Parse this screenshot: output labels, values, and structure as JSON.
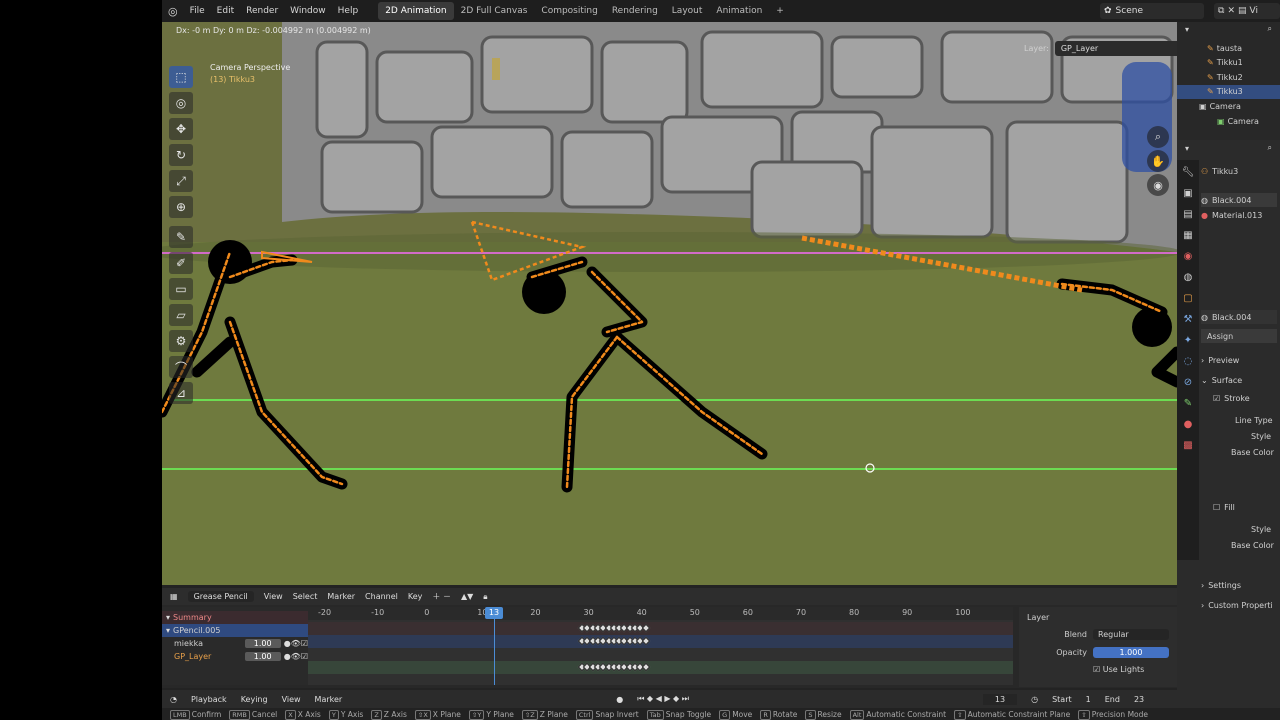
{
  "topbar": {
    "menu": [
      "File",
      "Edit",
      "Render",
      "Window",
      "Help"
    ],
    "workspaces": [
      "2D Animation",
      "2D Full Canvas",
      "Compositing",
      "Rendering",
      "Layout",
      "Animation",
      "+"
    ],
    "active_workspace": "2D Animation",
    "scene": "Scene",
    "view_layer": "Vi"
  },
  "viewport": {
    "header_text": "Dx: -0 m  Dy: 0 m  Dz: -0.004992 m (0.004992 m)",
    "info_title": "Camera Perspective",
    "info_sub": "(13) Tikku3",
    "layer_label": "Layer:",
    "layer_value": "GP_Layer",
    "tools": [
      "select-box",
      "cursor",
      "move",
      "rotate",
      "scale",
      "transform",
      "annotate",
      "draw",
      "box",
      "polyline",
      "mesh",
      "pivot",
      "measure"
    ]
  },
  "timeline": {
    "editor": "Grease Pencil",
    "menus": [
      "View",
      "Select",
      "Marker",
      "Channel",
      "Key"
    ],
    "ruler": [
      "-20",
      "-10",
      "0",
      "10",
      "20",
      "30",
      "40",
      "50",
      "60",
      "70",
      "80",
      "90",
      "100"
    ],
    "current_frame": "13",
    "channels": [
      {
        "name": "Summary",
        "value": ""
      },
      {
        "name": "GPencil.005",
        "value": ""
      },
      {
        "name": "miekka",
        "value": "1.00"
      },
      {
        "name": "GP_Layer",
        "value": "1.00"
      }
    ],
    "layer_panel": {
      "title": "Layer",
      "blend_label": "Blend",
      "blend_value": "Regular",
      "opacity_label": "Opacity",
      "opacity_value": "1.000",
      "use_lights": "Use Lights"
    }
  },
  "playback": {
    "menus": [
      "Playback",
      "Keying",
      "View",
      "Marker"
    ],
    "frame": "13",
    "start_label": "Start",
    "start": "1",
    "end_label": "End",
    "end": "23"
  },
  "statusbar": [
    {
      "key": "LMB",
      "text": "Confirm"
    },
    {
      "key": "RMB",
      "text": "Cancel"
    },
    {
      "key": "X",
      "text": "X Axis"
    },
    {
      "key": "Y",
      "text": "Y Axis"
    },
    {
      "key": "Z",
      "text": "Z Axis"
    },
    {
      "key": "⇧X",
      "text": "X Plane"
    },
    {
      "key": "⇧Y",
      "text": "Y Plane"
    },
    {
      "key": "⇧Z",
      "text": "Z Plane"
    },
    {
      "key": "Ctrl",
      "text": "Snap Invert"
    },
    {
      "key": "Tab",
      "text": "Snap Toggle"
    },
    {
      "key": "G",
      "text": "Move"
    },
    {
      "key": "R",
      "text": "Rotate"
    },
    {
      "key": "S",
      "text": "Resize"
    },
    {
      "key": "Alt",
      "text": "Automatic Constraint"
    },
    {
      "key": "⇧",
      "text": "Automatic Constraint Plane"
    },
    {
      "key": "⇧",
      "text": "Precision Mode"
    }
  ],
  "outliner": [
    {
      "name": "tausta",
      "type": "gp"
    },
    {
      "name": "Tikku1",
      "type": "gp"
    },
    {
      "name": "Tikku2",
      "type": "gp"
    },
    {
      "name": "Tikku3",
      "type": "gp"
    },
    {
      "name": "Camera",
      "type": "cam"
    },
    {
      "name": "Camera",
      "type": "camdata"
    }
  ],
  "properties": {
    "object": "Tikku3",
    "materials": [
      "Black.004",
      "Material.013"
    ],
    "active_material": "Black.004",
    "assign": "Assign",
    "preview": "Preview",
    "surface": "Surface",
    "stroke": "Stroke",
    "line_type": "Line Type",
    "style": "Style",
    "base_color": "Base Color",
    "fill": "Fill",
    "fill_style": "Style",
    "fill_base_color": "Base Color",
    "settings": "Settings",
    "custom_props": "Custom Properti"
  },
  "colors": {
    "accent": "#4472c4",
    "stroke_orange": "#f08a1c",
    "ground": "#6f7a3e",
    "wall": "#7d7d7d"
  }
}
